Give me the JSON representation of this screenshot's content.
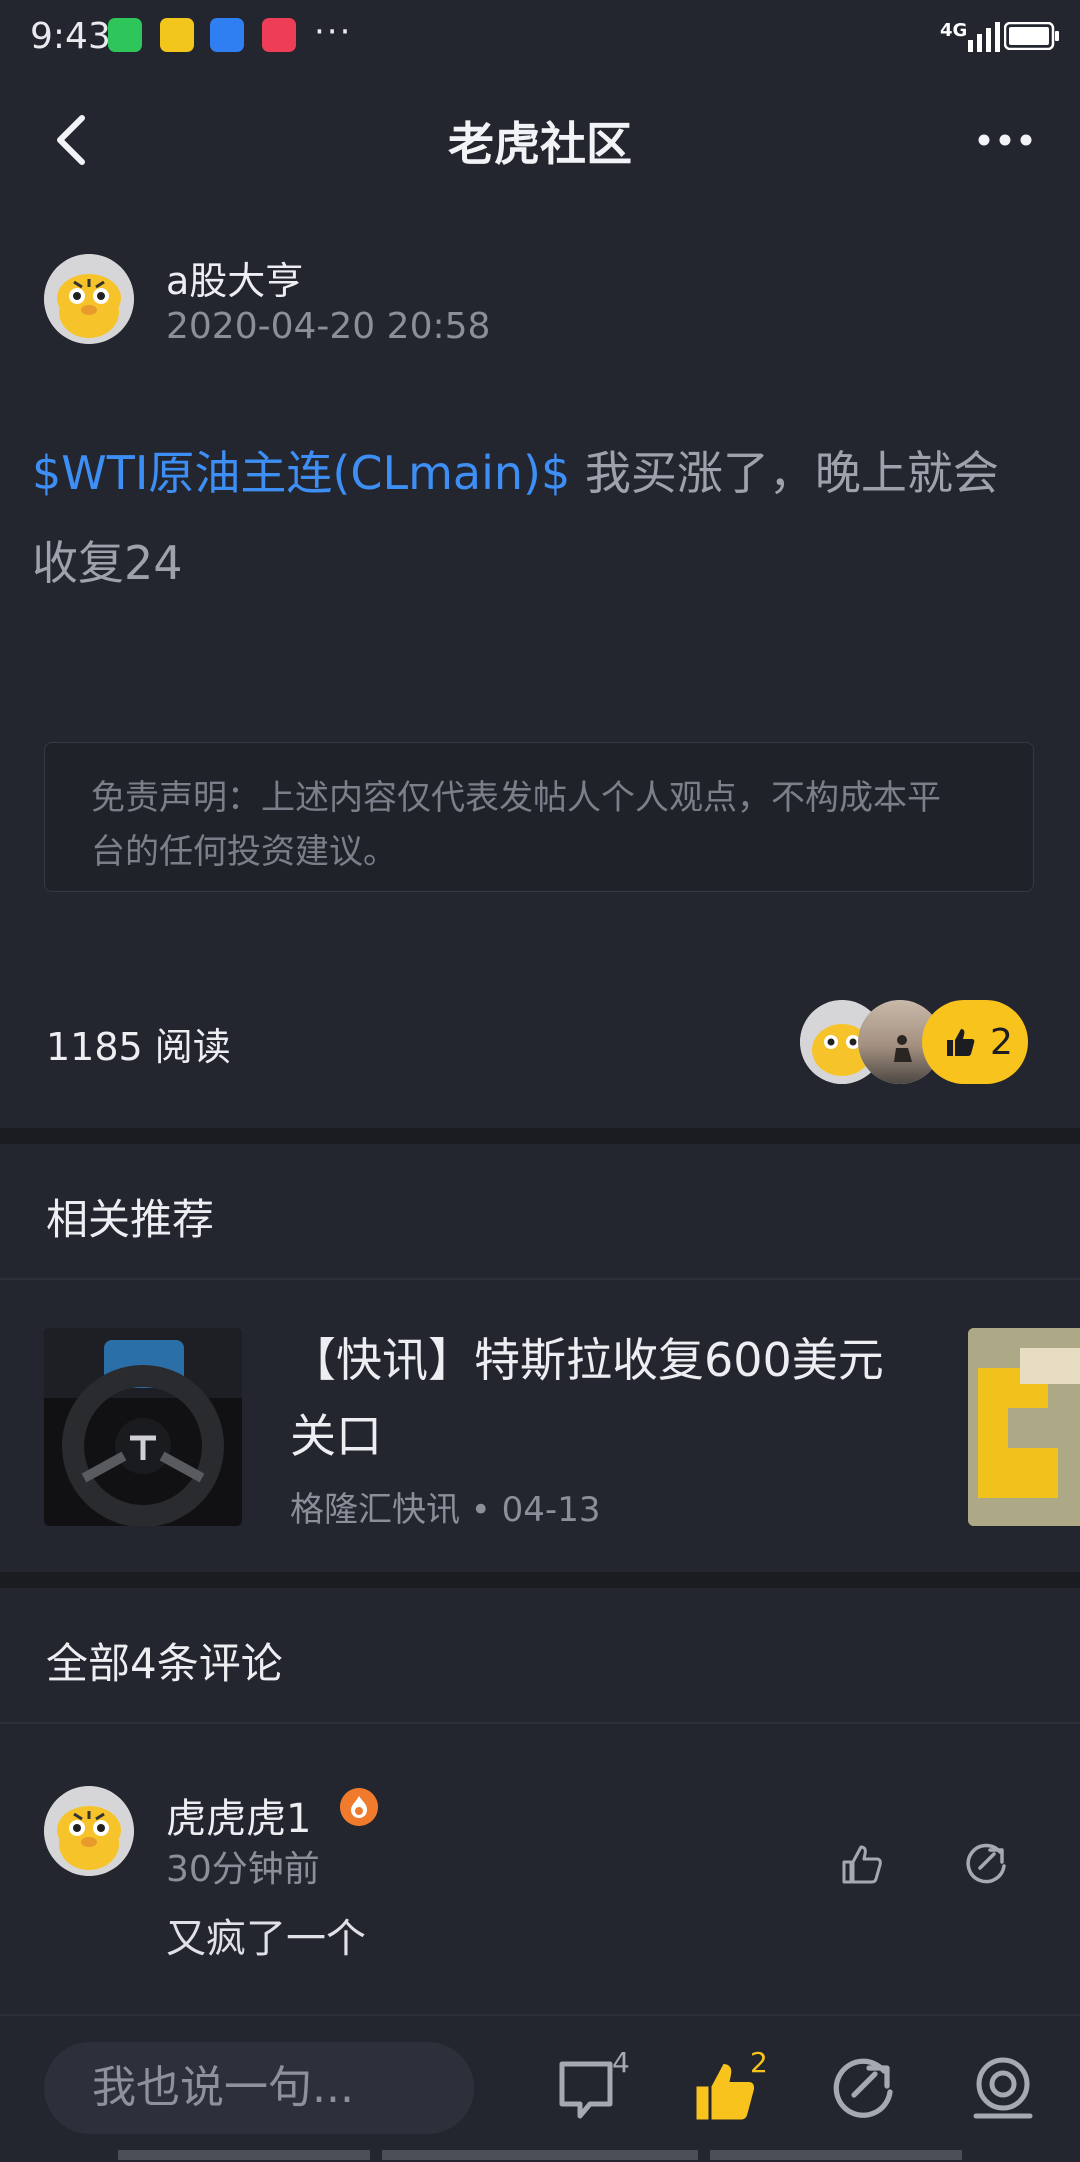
{
  "status_bar": {
    "time": "9:43",
    "network": "4G",
    "more": "···"
  },
  "header": {
    "title": "老虎社区"
  },
  "author": {
    "name": "a股大亨",
    "timestamp": "2020-04-20 20:58"
  },
  "post": {
    "tag": "$WTI原油主连(CLmain)$",
    "text_line1": "我买涨了，晚上就会",
    "text_line2": "收复24"
  },
  "disclaimer": {
    "line1": "免责声明：上述内容仅代表发帖人个人观点，不构成本平",
    "line2": "台的任何投资建议。"
  },
  "stats": {
    "reads": "1185 阅读",
    "likes": "2"
  },
  "recommend": {
    "heading": "相关推荐",
    "items": [
      {
        "title_line1": "【快讯】特斯拉收复600美元",
        "title_line2": "关口",
        "source": "格隆汇快讯 • 04-13"
      }
    ]
  },
  "comments": {
    "heading": "全部4条评论",
    "items": [
      {
        "user": "虎虎虎1",
        "time": "30分钟前",
        "text": "又疯了一个"
      }
    ]
  },
  "bottom_bar": {
    "input_placeholder": "我也说一句...",
    "comment_count": "4",
    "like_count": "2"
  },
  "colors": {
    "accent_blue": "#3d8ef5",
    "like_yellow": "#f7c31c",
    "background": "#23252f"
  }
}
